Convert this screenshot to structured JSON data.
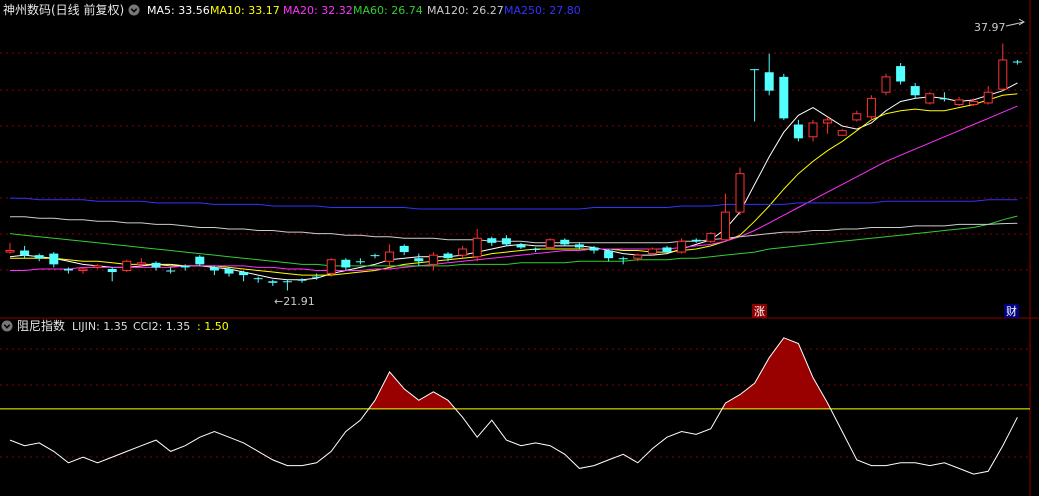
{
  "header": {
    "title": "神州数码(日线 前复权)",
    "ma_items": [
      {
        "label": "MA5: 33.56",
        "color": "#ffffff"
      },
      {
        "label": "MA10: 33.17",
        "color": "#ffff00"
      },
      {
        "label": "MA20: 32.32",
        "color": "#ff33ff"
      },
      {
        "label": "MA60: 26.74",
        "color": "#33cc33"
      },
      {
        "label": "MA120: 26.27",
        "color": "#cccccc"
      },
      {
        "label": "MA250: 27.80",
        "color": "#3333ff"
      }
    ]
  },
  "indicator_header": {
    "title": "阻尼指数",
    "items": [
      {
        "label": "LIJIN: 1.35",
        "color": "#dddddd"
      },
      {
        "label": "CCI2: 1.35",
        "color": "#dddddd"
      },
      {
        "label": ": 1.50",
        "color": "#ffff00"
      }
    ]
  },
  "annotations": {
    "high_label": "37.97",
    "low_label": "←21.91",
    "badge_zhang": "涨",
    "badge_cai": "财"
  },
  "colors": {
    "up": "#ff3333",
    "down": "#54ffff",
    "grid": "#8b0000",
    "threshold": "#ffff00",
    "fill": "#990000"
  },
  "chart_data": [
    {
      "type": "candlestick",
      "title": "神州数码(日线 前复权)",
      "ylim": [
        20.5,
        39.5
      ],
      "high": 37.97,
      "low": 21.91,
      "candles": [
        [
          0,
          24.4,
          24.5,
          24.3,
          25.0
        ],
        [
          1,
          24.5,
          24.2,
          24.0,
          24.8
        ],
        [
          2,
          24.2,
          24.0,
          23.8,
          24.3
        ],
        [
          3,
          24.3,
          23.6,
          23.4,
          24.4
        ],
        [
          4,
          23.3,
          23.2,
          23.0,
          23.4
        ],
        [
          5,
          23.2,
          23.3,
          23.0,
          23.4
        ],
        [
          6,
          23.4,
          23.5,
          23.3,
          23.6
        ],
        [
          7,
          23.3,
          23.1,
          22.5,
          23.4
        ],
        [
          8,
          23.2,
          23.8,
          23.1,
          23.9
        ],
        [
          9,
          23.6,
          23.7,
          23.5,
          24.0
        ],
        [
          10,
          23.7,
          23.4,
          23.2,
          23.8
        ],
        [
          11,
          23.2,
          23.2,
          23.0,
          23.4
        ],
        [
          12,
          23.5,
          23.4,
          23.2,
          23.6
        ],
        [
          13,
          24.1,
          23.6,
          23.5,
          24.2
        ],
        [
          14,
          23.4,
          23.2,
          22.9,
          23.5
        ],
        [
          15,
          23.3,
          23.0,
          22.8,
          23.4
        ],
        [
          16,
          23.1,
          22.9,
          22.5,
          23.2
        ],
        [
          17,
          22.7,
          22.7,
          22.4,
          22.8
        ],
        [
          18,
          22.5,
          22.4,
          22.2,
          22.6
        ],
        [
          19,
          22.5,
          22.5,
          21.9,
          22.6
        ],
        [
          20,
          22.6,
          22.6,
          22.4,
          22.7
        ],
        [
          21,
          22.8,
          22.8,
          22.6,
          23.0
        ],
        [
          22,
          23.0,
          23.9,
          22.8,
          24.0
        ],
        [
          23,
          23.9,
          23.4,
          23.2,
          24.0
        ],
        [
          24,
          23.8,
          23.8,
          23.6,
          24.0
        ],
        [
          25,
          24.2,
          24.2,
          24.0,
          24.3
        ],
        [
          26,
          23.8,
          24.4,
          23.5,
          24.9
        ],
        [
          27,
          24.8,
          24.4,
          24.2,
          24.9
        ],
        [
          28,
          24.0,
          23.8,
          23.5,
          24.3
        ],
        [
          29,
          23.6,
          24.2,
          23.2,
          24.4
        ],
        [
          30,
          24.3,
          24.0,
          23.8,
          24.4
        ],
        [
          31,
          24.2,
          24.6,
          24.0,
          24.8
        ],
        [
          32,
          24.1,
          25.3,
          23.8,
          25.9
        ],
        [
          33,
          25.3,
          25.0,
          24.8,
          25.4
        ],
        [
          34,
          25.3,
          24.9,
          24.8,
          25.5
        ],
        [
          35,
          24.9,
          24.7,
          24.6,
          25.0
        ],
        [
          36,
          24.6,
          24.6,
          24.4,
          24.7
        ],
        [
          37,
          24.7,
          25.2,
          24.6,
          25.3
        ],
        [
          38,
          25.2,
          24.9,
          24.8,
          25.3
        ],
        [
          39,
          24.9,
          24.7,
          24.6,
          25.0
        ],
        [
          40,
          24.7,
          24.5,
          24.3,
          24.8
        ],
        [
          41,
          24.5,
          24.0,
          23.8,
          24.6
        ],
        [
          42,
          24.0,
          24.0,
          23.6,
          24.1
        ],
        [
          43,
          24.0,
          24.2,
          23.8,
          24.3
        ],
        [
          44,
          24.3,
          24.6,
          24.2,
          24.7
        ],
        [
          45,
          24.7,
          24.4,
          24.3,
          24.8
        ],
        [
          46,
          24.4,
          25.1,
          24.3,
          25.3
        ],
        [
          47,
          25.2,
          25.1,
          25.0,
          25.3
        ],
        [
          48,
          25.1,
          25.6,
          25.0,
          25.7
        ],
        [
          49,
          25.2,
          27.0,
          25.1,
          28.2
        ],
        [
          50,
          27.0,
          29.5,
          26.8,
          29.9
        ],
        [
          51,
          36.3,
          36.3,
          32.9,
          36.3
        ],
        [
          52,
          36.1,
          34.9,
          34.6,
          37.3
        ],
        [
          53,
          35.8,
          33.1,
          33.0,
          36.0
        ],
        [
          54,
          32.7,
          31.8,
          31.6,
          33.0
        ],
        [
          55,
          31.9,
          32.8,
          31.6,
          33.0
        ],
        [
          56,
          32.8,
          33.0,
          32.1,
          33.2
        ],
        [
          57,
          32.0,
          32.3,
          32.0,
          32.4
        ],
        [
          58,
          33.0,
          33.4,
          32.9,
          33.6
        ],
        [
          59,
          33.2,
          34.4,
          33.0,
          34.6
        ],
        [
          60,
          34.8,
          35.8,
          34.6,
          36.0
        ],
        [
          61,
          36.5,
          35.5,
          35.3,
          36.7
        ],
        [
          62,
          35.2,
          34.6,
          34.4,
          35.4
        ],
        [
          63,
          34.1,
          34.7,
          34.0,
          34.8
        ],
        [
          64,
          34.4,
          34.4,
          34.2,
          34.8
        ],
        [
          65,
          34.0,
          34.3,
          33.9,
          34.5
        ],
        [
          66,
          34.0,
          34.2,
          33.9,
          34.4
        ],
        [
          67,
          34.1,
          34.8,
          34.0,
          35.2
        ],
        [
          68,
          35.0,
          36.9,
          34.9,
          37.97
        ],
        [
          69,
          36.8,
          36.8,
          36.6,
          36.9
        ]
      ],
      "series": [
        {
          "name": "MA5",
          "values": [
            24.1,
            24.2,
            24.1,
            24.0,
            23.8,
            23.6,
            23.5,
            23.4,
            23.4,
            23.5,
            23.6,
            23.6,
            23.5,
            23.5,
            23.4,
            23.3,
            23.1,
            22.9,
            22.7,
            22.6,
            22.6,
            22.7,
            23.0,
            23.2,
            23.4,
            23.6,
            23.9,
            24.0,
            24.1,
            24.1,
            24.1,
            24.2,
            24.4,
            24.6,
            24.8,
            24.9,
            24.8,
            24.8,
            24.8,
            24.8,
            24.7,
            24.5,
            24.3,
            24.2,
            24.2,
            24.3,
            24.6,
            24.9,
            25.2,
            25.9,
            27.0,
            28.8,
            30.6,
            32.2,
            33.3,
            33.8,
            33.2,
            32.6,
            32.4,
            32.8,
            33.6,
            34.2,
            34.4,
            34.5,
            34.4,
            34.2,
            34.3,
            34.6,
            34.9,
            35.4
          ]
        },
        {
          "name": "MA10",
          "values": [
            24.0,
            24.0,
            24.0,
            24.0,
            23.9,
            23.8,
            23.8,
            23.7,
            23.6,
            23.6,
            23.6,
            23.5,
            23.5,
            23.5,
            23.5,
            23.4,
            23.3,
            23.2,
            23.1,
            23.0,
            22.9,
            22.9,
            22.9,
            23.0,
            23.1,
            23.2,
            23.4,
            23.6,
            23.7,
            23.8,
            23.9,
            24.0,
            24.1,
            24.3,
            24.4,
            24.5,
            24.6,
            24.6,
            24.6,
            24.6,
            24.6,
            24.6,
            24.5,
            24.5,
            24.4,
            24.4,
            24.5,
            24.6,
            24.8,
            25.1,
            25.5,
            26.4,
            27.4,
            28.5,
            29.5,
            30.3,
            31.0,
            31.6,
            32.3,
            33.0,
            33.4,
            33.6,
            33.7,
            33.6,
            33.6,
            33.8,
            34.0,
            34.3,
            34.6,
            34.7
          ]
        },
        {
          "name": "MA20",
          "values": [
            23.2,
            23.2,
            23.3,
            23.3,
            23.3,
            23.4,
            23.4,
            23.4,
            23.4,
            23.4,
            23.4,
            23.4,
            23.5,
            23.5,
            23.5,
            23.5,
            23.5,
            23.4,
            23.4,
            23.3,
            23.3,
            23.2,
            23.2,
            23.2,
            23.2,
            23.3,
            23.3,
            23.4,
            23.5,
            23.6,
            23.7,
            23.8,
            23.9,
            24.0,
            24.1,
            24.2,
            24.3,
            24.4,
            24.5,
            24.5,
            24.6,
            24.6,
            24.6,
            24.6,
            24.6,
            24.6,
            24.7,
            24.8,
            24.9,
            25.1,
            25.4,
            25.8,
            26.3,
            26.8,
            27.3,
            27.8,
            28.3,
            28.8,
            29.3,
            29.8,
            30.3,
            30.7,
            31.1,
            31.5,
            31.9,
            32.3,
            32.7,
            33.1,
            33.5,
            33.9
          ]
        },
        {
          "name": "MA60",
          "values": [
            25.6,
            25.5,
            25.4,
            25.3,
            25.2,
            25.1,
            25.0,
            24.9,
            24.8,
            24.7,
            24.6,
            24.5,
            24.4,
            24.3,
            24.2,
            24.1,
            24.0,
            23.9,
            23.8,
            23.7,
            23.6,
            23.6,
            23.5,
            23.5,
            23.5,
            23.5,
            23.5,
            23.5,
            23.5,
            23.5,
            23.5,
            23.6,
            23.6,
            23.6,
            23.6,
            23.7,
            23.7,
            23.7,
            23.7,
            23.8,
            23.8,
            23.8,
            23.8,
            23.9,
            23.9,
            23.9,
            24.0,
            24.0,
            24.1,
            24.2,
            24.3,
            24.4,
            24.6,
            24.7,
            24.8,
            24.9,
            25.0,
            25.1,
            25.2,
            25.3,
            25.4,
            25.5,
            25.6,
            25.7,
            25.8,
            25.9,
            26.0,
            26.2,
            26.5,
            26.74
          ]
        },
        {
          "name": "MA120",
          "values": [
            26.7,
            26.7,
            26.6,
            26.6,
            26.5,
            26.5,
            26.4,
            26.4,
            26.3,
            26.3,
            26.2,
            26.2,
            26.1,
            26.0,
            26.0,
            25.9,
            25.9,
            25.8,
            25.8,
            25.7,
            25.7,
            25.6,
            25.6,
            25.5,
            25.5,
            25.4,
            25.4,
            25.3,
            25.3,
            25.3,
            25.2,
            25.2,
            25.2,
            25.1,
            25.1,
            25.1,
            25.0,
            25.0,
            25.0,
            25.0,
            25.0,
            25.0,
            25.0,
            25.0,
            25.0,
            25.0,
            25.1,
            25.1,
            25.2,
            25.3,
            25.4,
            25.5,
            25.6,
            25.7,
            25.7,
            25.8,
            25.8,
            25.9,
            25.9,
            26.0,
            26.0,
            26.0,
            26.1,
            26.1,
            26.1,
            26.2,
            26.2,
            26.2,
            26.25,
            26.27
          ]
        },
        {
          "name": "MA250",
          "values": [
            27.9,
            27.9,
            27.8,
            27.8,
            27.8,
            27.8,
            27.7,
            27.7,
            27.7,
            27.7,
            27.6,
            27.6,
            27.6,
            27.6,
            27.5,
            27.5,
            27.5,
            27.5,
            27.4,
            27.4,
            27.4,
            27.4,
            27.3,
            27.3,
            27.3,
            27.3,
            27.3,
            27.3,
            27.2,
            27.2,
            27.2,
            27.2,
            27.2,
            27.2,
            27.2,
            27.2,
            27.2,
            27.2,
            27.2,
            27.2,
            27.3,
            27.3,
            27.3,
            27.3,
            27.3,
            27.3,
            27.4,
            27.4,
            27.4,
            27.5,
            27.5,
            27.5,
            27.5,
            27.5,
            27.6,
            27.6,
            27.6,
            27.6,
            27.6,
            27.6,
            27.7,
            27.7,
            27.7,
            27.7,
            27.7,
            27.7,
            27.7,
            27.8,
            27.8,
            27.8
          ]
        }
      ]
    },
    {
      "type": "line",
      "title": "阻尼指数",
      "ylim": [
        0.0,
        2.8
      ],
      "threshold": 1.5,
      "series": [
        {
          "name": "LIJIN",
          "values": [
            0.95,
            0.85,
            0.9,
            0.75,
            0.55,
            0.65,
            0.55,
            0.65,
            0.75,
            0.85,
            0.95,
            0.75,
            0.85,
            1.0,
            1.1,
            1.0,
            0.9,
            0.75,
            0.6,
            0.5,
            0.5,
            0.55,
            0.75,
            1.1,
            1.3,
            1.65,
            2.15,
            1.85,
            1.65,
            1.8,
            1.65,
            1.35,
            1.0,
            1.3,
            0.95,
            0.85,
            0.9,
            0.85,
            0.7,
            0.45,
            0.5,
            0.6,
            0.7,
            0.55,
            0.8,
            1.0,
            1.1,
            1.05,
            1.15,
            1.6,
            1.75,
            1.95,
            2.4,
            2.75,
            2.65,
            2.05,
            1.6,
            1.1,
            0.6,
            0.5,
            0.5,
            0.55,
            0.55,
            0.5,
            0.55,
            0.45,
            0.35,
            0.4,
            0.85,
            1.35
          ]
        }
      ]
    }
  ]
}
